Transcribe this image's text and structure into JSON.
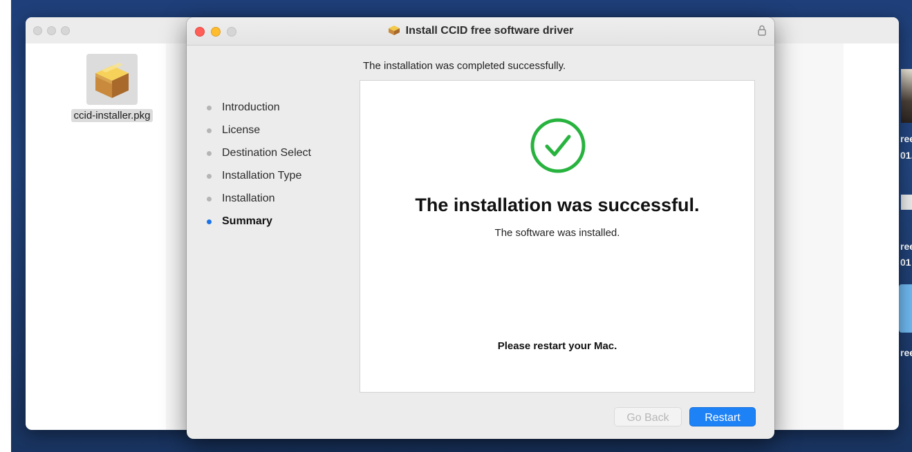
{
  "finder": {
    "file_name": "ccid-installer.pkg",
    "file_icon": "package-icon"
  },
  "installer": {
    "title": "Install CCID free software driver",
    "title_icon": "package-icon",
    "lock_icon": "lock-icon",
    "header_message": "The installation was completed successfully.",
    "steps": [
      {
        "label": "Introduction",
        "active": false
      },
      {
        "label": "License",
        "active": false
      },
      {
        "label": "Destination Select",
        "active": false
      },
      {
        "label": "Installation Type",
        "active": false
      },
      {
        "label": "Installation",
        "active": false
      },
      {
        "label": "Summary",
        "active": true
      }
    ],
    "success_icon": "checkmark-circle-icon",
    "success_title": "The installation was successful.",
    "success_subtitle": "The software was installed.",
    "restart_message": "Please restart your Mac.",
    "buttons": {
      "go_back": "Go Back",
      "restart": "Restart"
    }
  },
  "edge_text": [
    "ree",
    "01.",
    "ree",
    "01",
    "ree"
  ],
  "colors": {
    "accent": "#1d82f6",
    "success": "#28b33f",
    "close": "#ff5f57",
    "minimize": "#febc2e"
  }
}
